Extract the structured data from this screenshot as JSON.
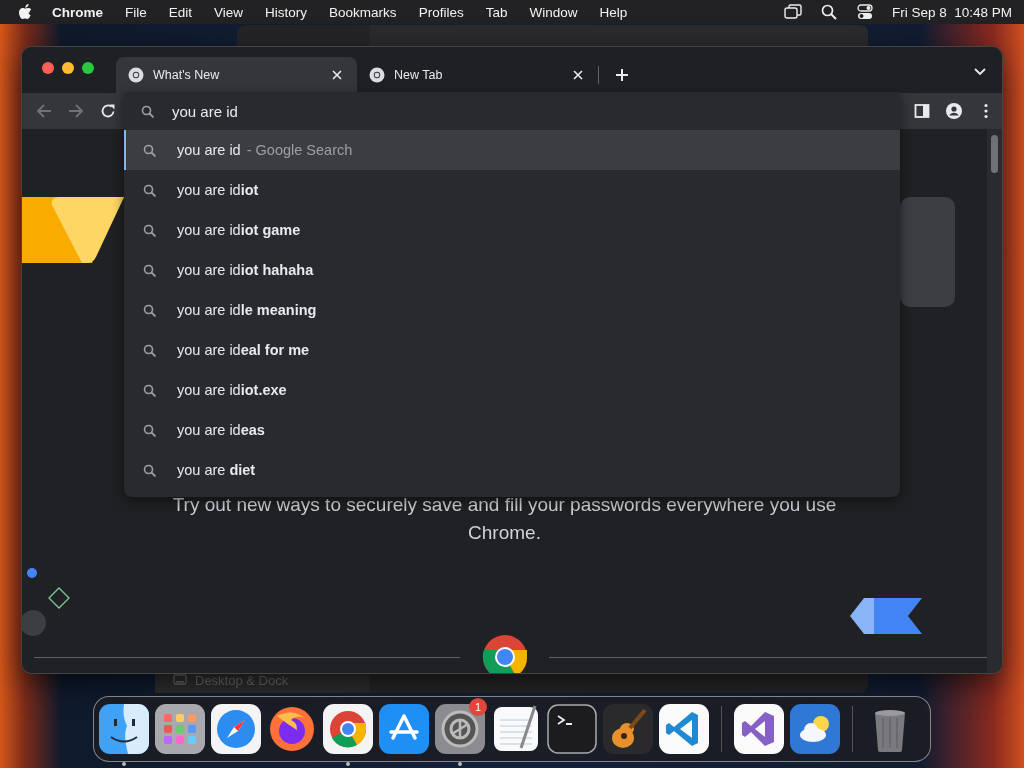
{
  "menubar": {
    "app_name": "Chrome",
    "menus": [
      "File",
      "Edit",
      "View",
      "History",
      "Bookmarks",
      "Profiles",
      "Tab",
      "Window",
      "Help"
    ],
    "clock": "Fri Sep 8  10:48 PM"
  },
  "background_window": {
    "sidebar_item": "Desktop & Dock"
  },
  "tabs": [
    {
      "title": "What's New",
      "selected": true
    },
    {
      "title": "New Tab",
      "selected": false
    }
  ],
  "omnibox": {
    "value": "you are id"
  },
  "suggestions": [
    {
      "text": "you are id",
      "detail": "- Google Search",
      "selected": true
    },
    {
      "text": "you are id**iot**",
      "selected": false
    },
    {
      "text": "you are id**iot game**",
      "selected": false
    },
    {
      "text": "you are id**iot hahaha**",
      "selected": false
    },
    {
      "text": "you are id**le meaning**",
      "selected": false
    },
    {
      "text": "you are id**eal for me**",
      "selected": false
    },
    {
      "text": "you are id**iot.exe**",
      "selected": false
    },
    {
      "text": "you are id**eas**",
      "selected": false
    },
    {
      "text": "you are **diet**",
      "selected": false
    }
  ],
  "page": {
    "body": "Try out new ways to securely save and fill your passwords everywhere you use Chrome."
  },
  "dock": [
    {
      "kind": "finder",
      "running": true
    },
    {
      "kind": "launchpad",
      "running": false
    },
    {
      "kind": "safari",
      "running": false
    },
    {
      "kind": "firefox",
      "running": false
    },
    {
      "kind": "chrome",
      "running": true
    },
    {
      "kind": "appstore",
      "running": false
    },
    {
      "kind": "settings",
      "running": true,
      "badge": "1"
    },
    {
      "kind": "textedit",
      "running": false
    },
    {
      "kind": "terminal",
      "running": false
    },
    {
      "kind": "garageband",
      "running": false
    },
    {
      "kind": "vscode",
      "running": false
    },
    {
      "kind": "separator"
    },
    {
      "kind": "visualstudio",
      "running": false
    },
    {
      "kind": "weather",
      "running": false
    },
    {
      "kind": "separator"
    },
    {
      "kind": "trash",
      "running": false
    }
  ]
}
